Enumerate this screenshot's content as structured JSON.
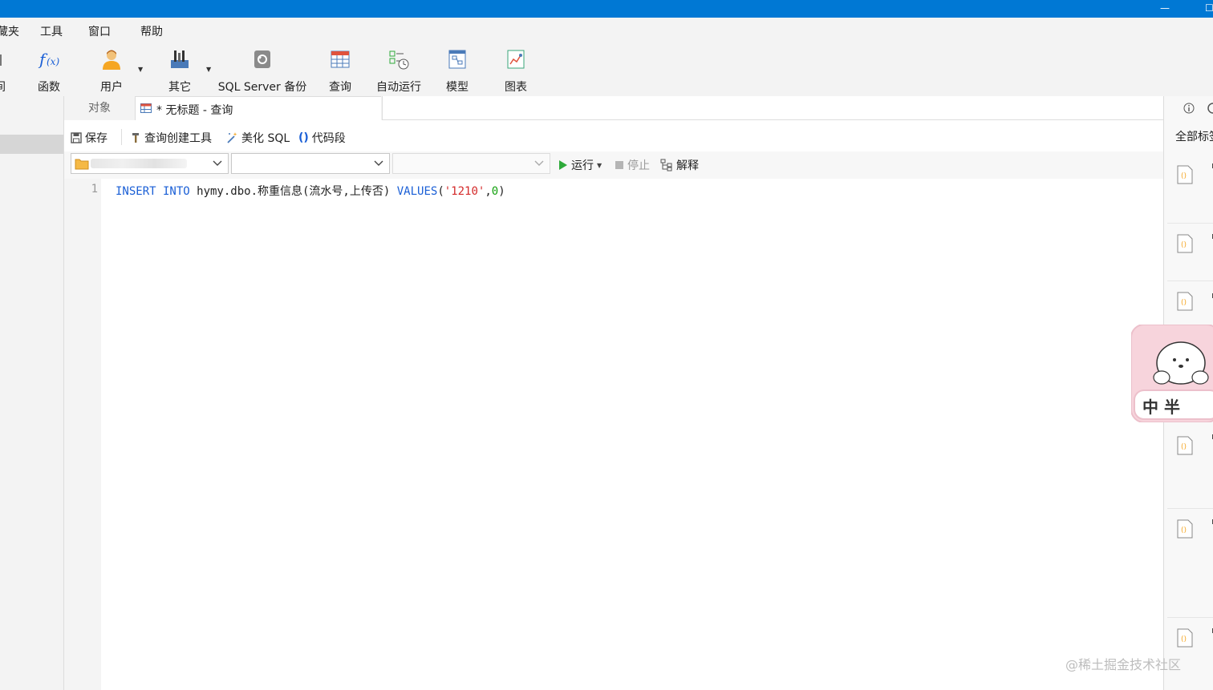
{
  "menu": {
    "items": [
      "藏夹",
      "工具",
      "窗口",
      "帮助"
    ]
  },
  "ribbon": {
    "items": [
      {
        "label": "间",
        "icon": "partial-icon"
      },
      {
        "label": "函数",
        "icon": "function-fx-icon"
      },
      {
        "label": "用户",
        "icon": "user-icon"
      },
      {
        "label": "其它",
        "icon": "tools-icon"
      },
      {
        "label": "SQL Server 备份",
        "icon": "backup-icon"
      },
      {
        "label": "查询",
        "icon": "query-table-icon"
      },
      {
        "label": "自动运行",
        "icon": "auto-run-icon"
      },
      {
        "label": "模型",
        "icon": "model-icon"
      },
      {
        "label": "图表",
        "icon": "chart-icon"
      }
    ]
  },
  "tabs": {
    "objects": "对象",
    "query": "* 无标题 - 查询"
  },
  "query_toolbar": {
    "save": "保存",
    "query_builder": "查询创建工具",
    "beautify": "美化 SQL",
    "snippet": "代码段"
  },
  "run_bar": {
    "connection": "",
    "database": "",
    "schema": "",
    "run": "运行",
    "stop": "停止",
    "explain": "解释"
  },
  "editor": {
    "line_number": "1",
    "kw_insert": "INSERT INTO",
    "table": " hymy.dbo.称重信息(流水号,上传否) ",
    "kw_values": "VALUES",
    "open": "(",
    "str_val": "'1210'",
    "comma": ",",
    "num_val": "0",
    "close": ")"
  },
  "right_panel": {
    "filter": "全部标签"
  },
  "sticker": {
    "text": "中 半"
  },
  "watermark": "@稀土掘金技术社区",
  "colors": {
    "titlebar": "#0078d4",
    "keyword": "#1a5fd6",
    "string": "#d42a2a",
    "number": "#13a10e",
    "run_green": "#2eaa3a"
  }
}
